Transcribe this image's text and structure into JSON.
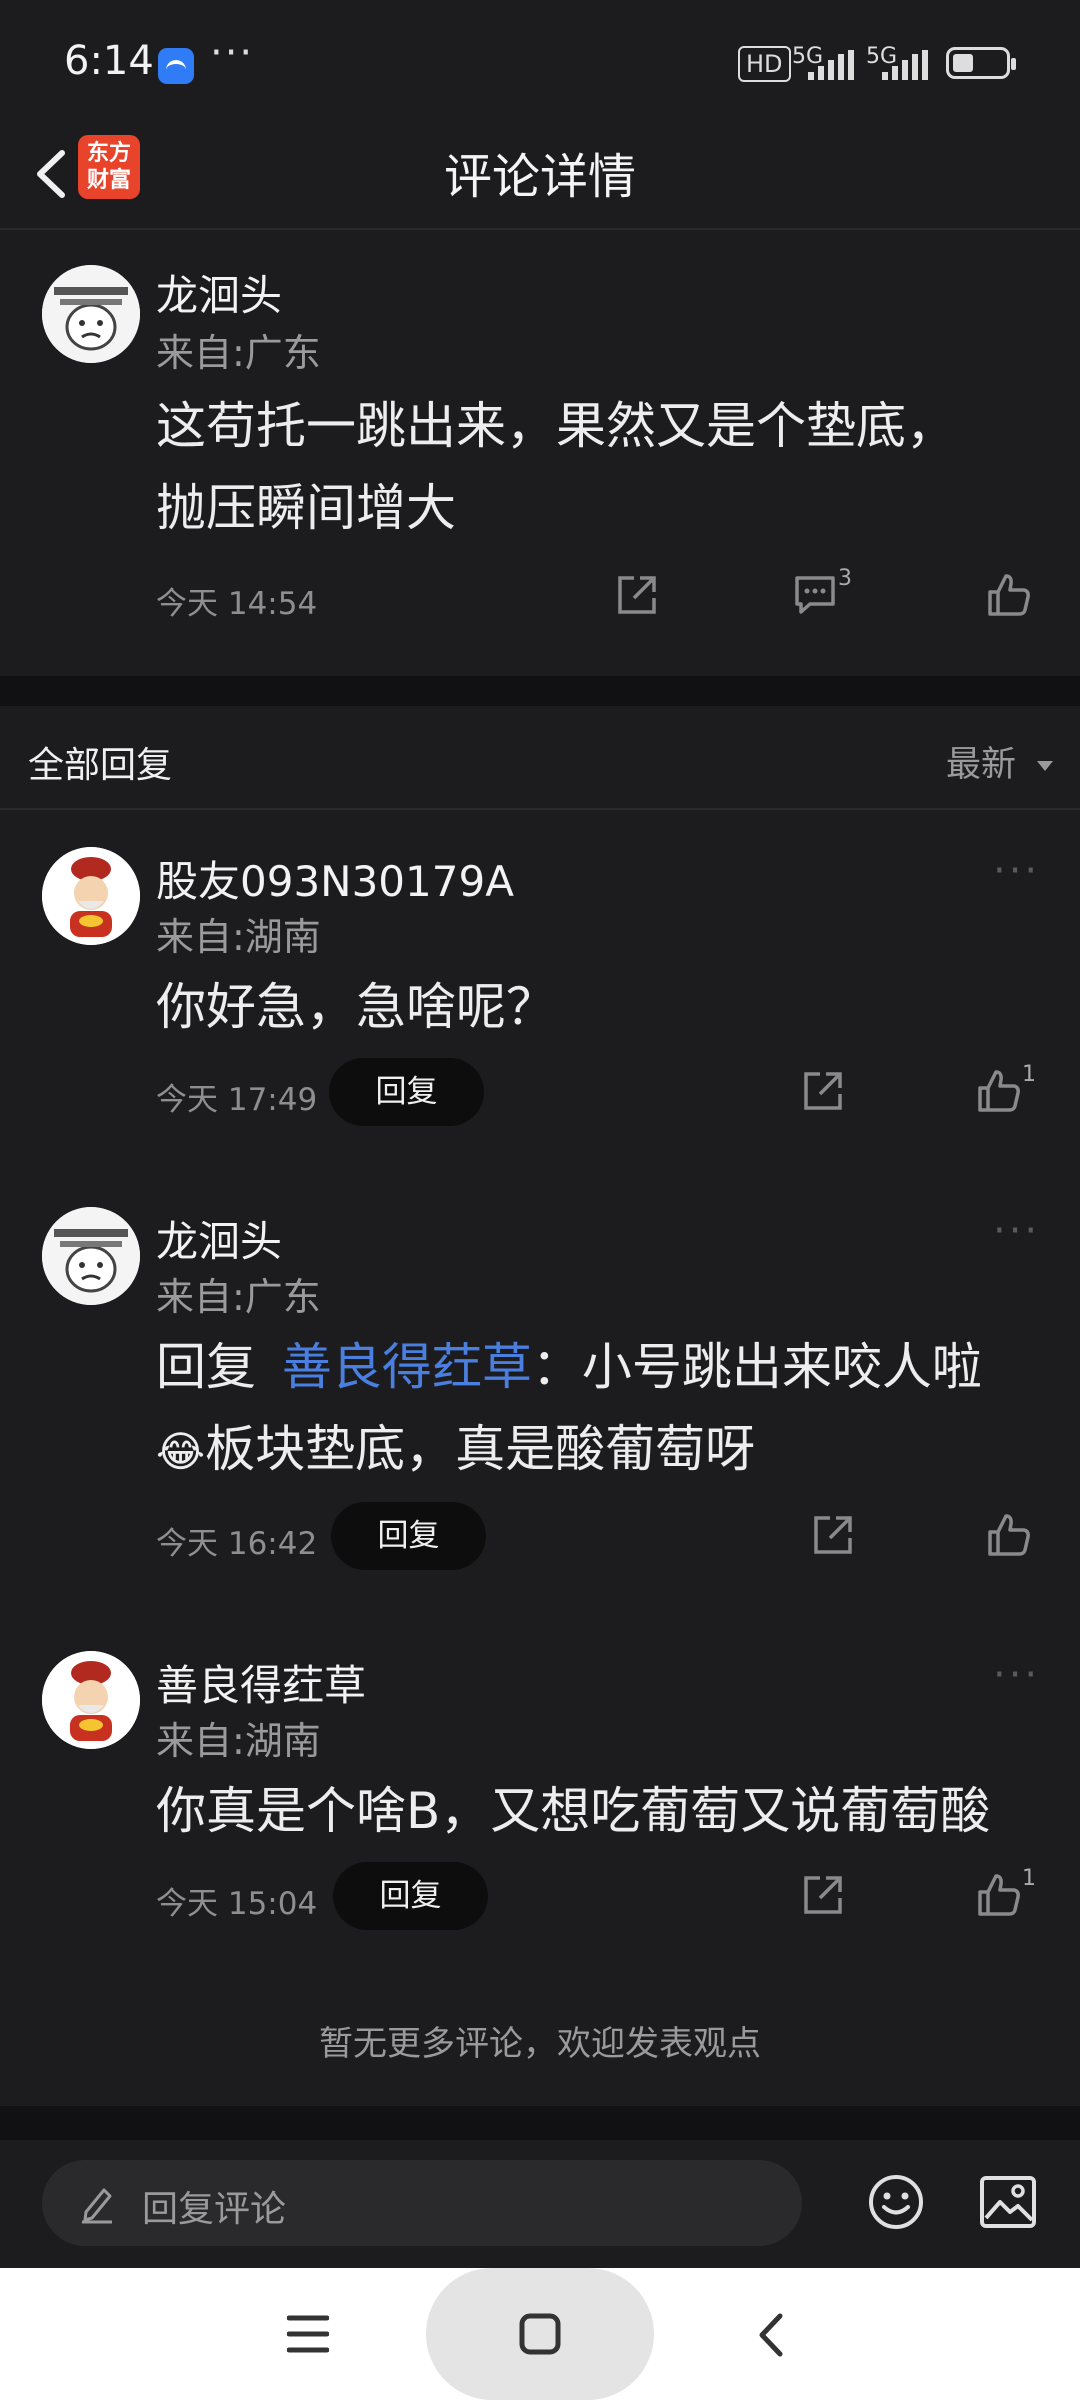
{
  "status_bar": {
    "time": "6:14",
    "more": "···",
    "hd_label": "HD",
    "signal1_label": "5G",
    "signal2_label": "5G"
  },
  "header": {
    "logo_text": "东方\n财富",
    "title": "评论详情"
  },
  "main_comment": {
    "author": "龙洄头",
    "location": "来自:广东",
    "text": "这苟托一跳出来，果然又是个垫底，\n抛压瞬间增大",
    "time": "今天 14:54",
    "comment_count": "3"
  },
  "replies_section": {
    "title": "全部回复",
    "sort_label": "最新"
  },
  "replies": [
    {
      "author": "股友093N30179A",
      "location": "来自:湖南",
      "text": "你好急，急啥呢？",
      "time": "今天 17:49",
      "reply_label": "回复",
      "like_count": "1"
    },
    {
      "author": "龙洄头",
      "location": "来自:广东",
      "reply_prefix": "回复",
      "reply_to": "善良得荭草",
      "text_part1": "：小号跳出来咬人啦",
      "emoji": "😂",
      "text_part2": "板块垫底，真是酸葡萄呀",
      "time": "今天 16:42",
      "reply_label": "回复"
    },
    {
      "author": "善良得荭草",
      "location": "来自:湖南",
      "text": "你真是个啥B，又想吃葡萄又说葡萄酸",
      "time": "今天 15:04",
      "reply_label": "回复",
      "like_count": "1"
    }
  ],
  "footer_note": "暂无更多评论，欢迎发表观点",
  "input": {
    "placeholder": "回复评论"
  },
  "colors": {
    "background": "#1c1c1e",
    "mention_blue": "#4a7fe0",
    "logo_red": "#e8432b"
  }
}
